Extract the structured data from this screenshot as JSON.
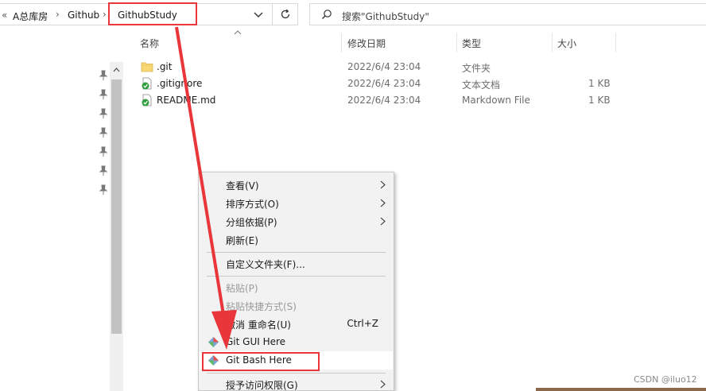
{
  "address": {
    "prefix": "«",
    "crumbs": [
      "A总库房",
      "Github",
      "GithubStudy"
    ],
    "separator": "›"
  },
  "search": {
    "placeholder": "搜索\"GithubStudy\""
  },
  "columns": [
    "名称",
    "修改日期",
    "类型",
    "大小"
  ],
  "files": [
    {
      "name": ".git",
      "date": "2022/6/4 23:04",
      "type": "文件夹",
      "size": "",
      "icon": "folder-icon"
    },
    {
      "name": ".gitignore",
      "date": "2022/6/4 23:04",
      "type": "文本文档",
      "size": "1 KB",
      "icon": "git-file-icon"
    },
    {
      "name": "README.md",
      "date": "2022/6/4 23:04",
      "type": "Markdown File",
      "size": "1 KB",
      "icon": "git-file-icon"
    }
  ],
  "context_menu": {
    "view": "查看(V)",
    "sort_by": "排序方式(O)",
    "group_by": "分组依据(P)",
    "refresh": "刷新(E)",
    "customize": "自定义文件夹(F)...",
    "paste": "粘贴(P)",
    "paste_shortcut": "粘贴快捷方式(S)",
    "undo_rename": "撤消 重命名(U)",
    "undo_shortcut": "Ctrl+Z",
    "git_gui": "Git GUI Here",
    "git_bash": "Git Bash Here",
    "grant_access": "授予访问权限(G)"
  },
  "watermark": "CSDN @iluo12",
  "colors": {
    "annotation_red": "#e8363a",
    "menu_bg": "#f2f2f2",
    "selected_row": "#ffffff"
  }
}
